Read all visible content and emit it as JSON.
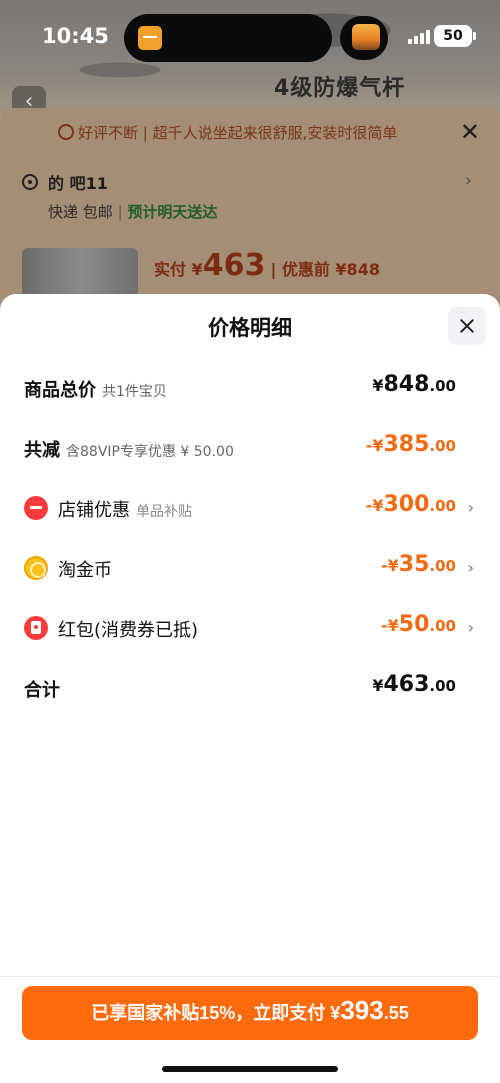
{
  "status_bar": {
    "time": "10:45",
    "battery": "50"
  },
  "background_page": {
    "banner_text": "4级防爆气杆",
    "notice": "好评不断 | 超千人说坐起来很舒服,安装时很简单",
    "address": "的 吧11",
    "shipping": "快递 包邮",
    "delivery": "预计明天送达",
    "price_label": "实付 ¥",
    "price": "463",
    "price_before": "| 优惠前 ¥848"
  },
  "sheet": {
    "title": "价格明细",
    "rows": [
      {
        "label": "商品总价",
        "sub": "共1件宝贝",
        "currency": "¥",
        "int": "848",
        "dec": ".00"
      },
      {
        "label": "共减",
        "sub": "含88VIP专享优惠 ¥ 50.00",
        "currency": "-¥",
        "int": "385",
        "dec": ".00"
      },
      {
        "label": "店铺优惠",
        "sub": "单品补贴",
        "currency": "-¥",
        "int": "300",
        "dec": ".00"
      },
      {
        "label": "淘金币",
        "sub": "",
        "currency": "-¥",
        "int": "35",
        "dec": ".00"
      },
      {
        "label": "红包(消费券已抵)",
        "sub": "",
        "currency": "-¥",
        "int": "50",
        "dec": ".00"
      },
      {
        "label": "合计",
        "sub": "",
        "currency": "¥",
        "int": "463",
        "dec": ".00"
      }
    ],
    "icons": [
      "store-icon",
      "coin-icon",
      "red-packet-icon"
    ]
  },
  "pay_button": {
    "prefix": "已享国家补贴15%，立即支付 ¥",
    "int": "393",
    "dec": ".55"
  },
  "colors": {
    "accent": "#ff6a0d",
    "discount": "#f46a12"
  }
}
